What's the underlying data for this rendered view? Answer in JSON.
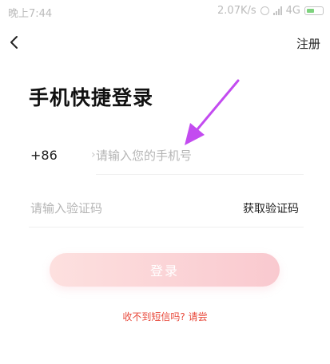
{
  "status_bar": {
    "time": "晚上7:44",
    "net_speed": "2.07K/s",
    "network": "4G",
    "icons": [
      "alarm-icon",
      "signal-icon",
      "battery-icon"
    ],
    "battery_level": 0.52
  },
  "nav": {
    "back_icon": "chevron-left-icon",
    "register_label": "注册"
  },
  "title": "手机快捷登录",
  "phone": {
    "country_code": "+86",
    "chevron": "›",
    "placeholder": "请输入您的手机号"
  },
  "verify": {
    "placeholder": "请输入验证码",
    "get_code_label": "获取验证码"
  },
  "login_label": "登录",
  "help_text": "收不到短信吗? 请尝",
  "colors": {
    "accent": "#e8483a",
    "button_start": "#fde0df",
    "button_end": "#f9c9cf",
    "annotation": "#c34bf0"
  }
}
